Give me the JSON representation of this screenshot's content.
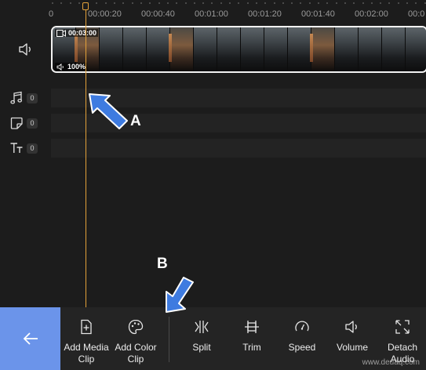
{
  "ruler": {
    "labels": [
      "0",
      "00:00:20",
      "00:00:40",
      "00:01:00",
      "00:01:20",
      "00:01:40",
      "00:02:00",
      "00:0"
    ]
  },
  "video_track": {
    "clip_duration": "00:03:00",
    "clip_volume": "100%"
  },
  "tracks": {
    "audio_count": "0",
    "sticker_count": "0",
    "text_count": "0"
  },
  "annotations": {
    "a": "A",
    "b": "B",
    "color": "#3e7be0"
  },
  "toolbar": {
    "add_media_clip": "Add Media\nClip",
    "add_color_clip": "Add Color\nClip",
    "split": "Split",
    "trim": "Trim",
    "speed": "Speed",
    "volume": "Volume",
    "detach_audio": "Detach\nAudio"
  },
  "watermark": "www.deuaq.com",
  "colors": {
    "accent_blue": "#6b94ea",
    "playhead": "#e4a23a"
  }
}
